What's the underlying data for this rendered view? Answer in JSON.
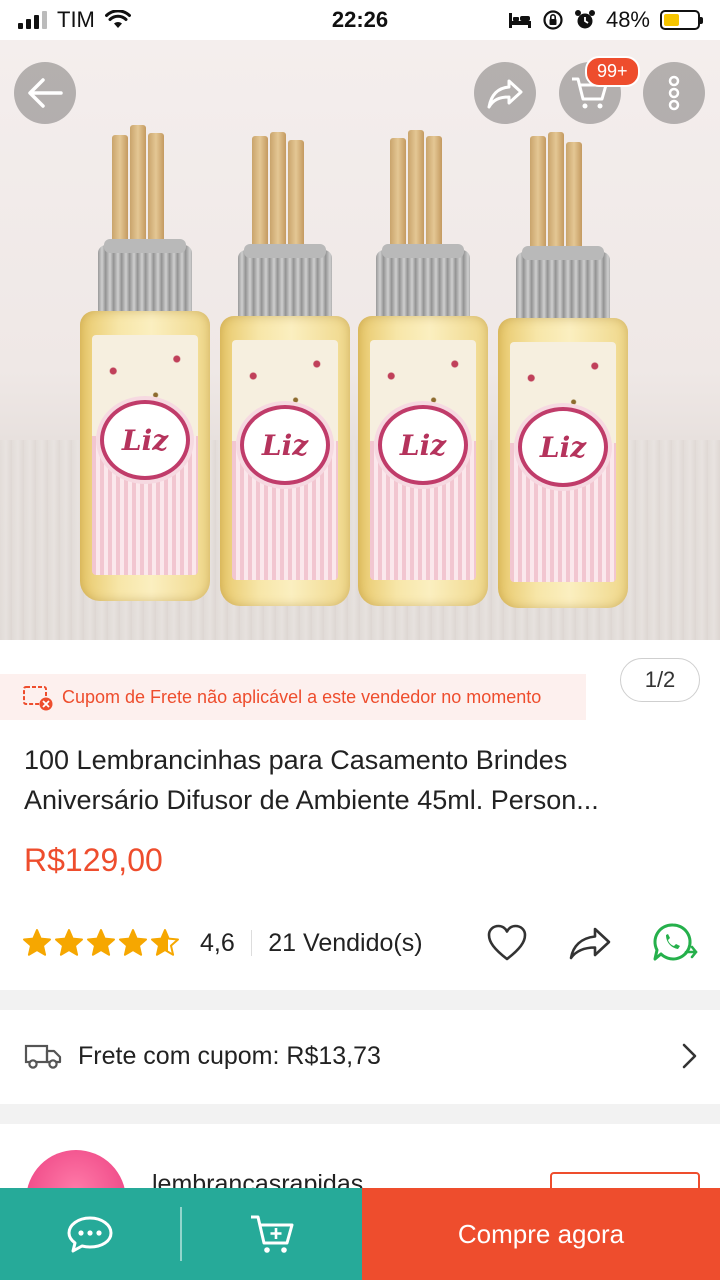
{
  "status_bar": {
    "carrier": "TIM",
    "time": "22:26",
    "battery_percent": "48%",
    "battery_level": 0.48
  },
  "image_nav": {
    "back_icon": "arrow-left-icon",
    "share_icon": "share-icon",
    "cart_icon": "cart-icon",
    "cart_badge": "99+",
    "more_icon": "more-vertical-icon",
    "bottle_label_text": "Liz"
  },
  "product": {
    "image_counter": "1/2",
    "coupon_notice": "Cupom de Frete não aplicável a este vendedor no momento",
    "title_line1": "100 Lembrancinhas para Casamento Brindes",
    "title_line2": "Aniversário Difusor de Ambiente 45ml. Person...",
    "price": "R$129,00",
    "rating": "4,6",
    "rating_value": 4.6,
    "sold": "21 Vendido(s)"
  },
  "shipping": {
    "label": "Frete com cupom: R$13,73"
  },
  "seller": {
    "name": "lembrancasrapidas"
  },
  "bottom_bar": {
    "buy_now_label": "Compre agora"
  },
  "colors": {
    "accent": "#ee4d2d",
    "teal": "#26aa99",
    "star": "#f6a700",
    "whatsapp": "#25b04b"
  }
}
